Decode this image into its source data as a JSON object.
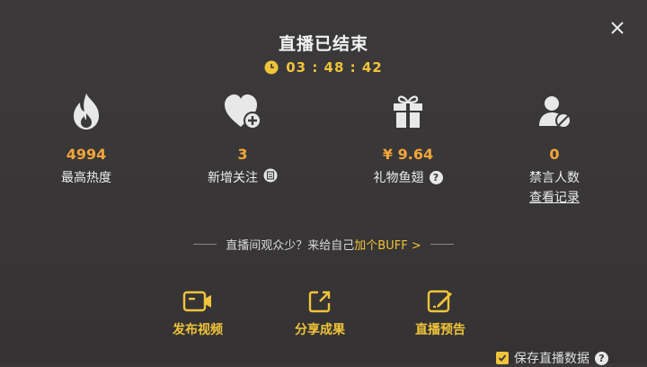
{
  "header": {
    "title": "直播已结束",
    "duration": "03 : 48 : 42"
  },
  "stats": [
    {
      "value": "4994",
      "label": "最高热度",
      "icon": "fire-icon"
    },
    {
      "value": "3",
      "label": "新增关注",
      "icon": "heart-plus-icon"
    },
    {
      "value": "¥ 9.64",
      "label": "礼物鱼翅",
      "icon": "gift-icon",
      "badge": "?"
    },
    {
      "value": "0",
      "label": "禁言人数",
      "link": "查看记录",
      "icon": "mute-user-icon"
    }
  ],
  "promo": {
    "text": "直播间观众少？来给自己",
    "link": "加个BUFF >"
  },
  "actions": [
    {
      "label": "发布视频",
      "icon": "video-camera-icon"
    },
    {
      "label": "分享成果",
      "icon": "share-icon"
    },
    {
      "label": "直播预告",
      "icon": "edit-notice-icon"
    }
  ],
  "footer": {
    "save_label": "保存直播数据",
    "badge": "?"
  },
  "colors": {
    "accent": "#f0c43a",
    "value": "#f3a53a",
    "background": "#3a3838"
  }
}
